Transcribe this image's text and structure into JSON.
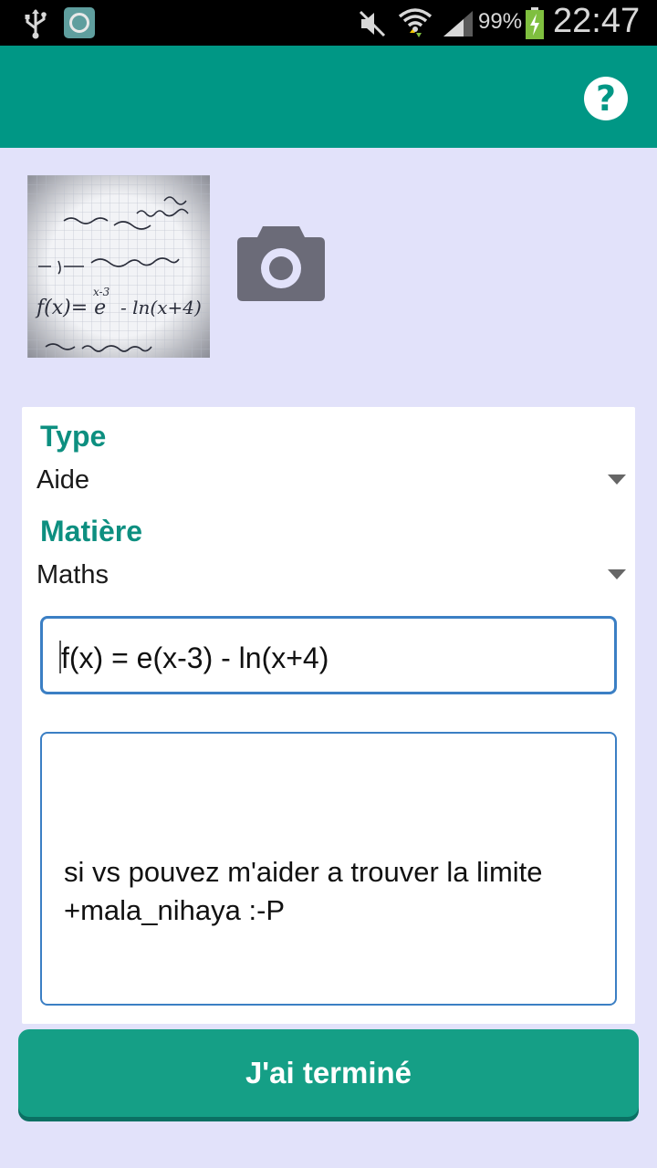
{
  "status_bar": {
    "battery_percent": "99%",
    "time": "22:47",
    "icons": [
      "usb-icon",
      "app-notification-icon",
      "mute-icon",
      "wifi-icon",
      "signal-icon",
      "battery-charging-icon"
    ]
  },
  "app_bar": {
    "help_label": "?",
    "icons": [
      "help-icon"
    ]
  },
  "photo": {
    "icons": [
      "photo-thumbnail",
      "camera-icon"
    ]
  },
  "form": {
    "type_label": "Type",
    "type_value": "Aide",
    "subject_label": "Matière",
    "subject_value": "Maths",
    "title_value": "f(x) = e(x-3) - ln(x+4)",
    "description_value": "si vs pouvez m'aider a trouver la limite\n+mala_nihaya :-P"
  },
  "submit_label": "J'ai terminé",
  "colors": {
    "primary": "#009785",
    "background": "#e2e2fa",
    "label": "#0d8f80",
    "input_border": "#3b7fc4",
    "button": "#159f86"
  }
}
